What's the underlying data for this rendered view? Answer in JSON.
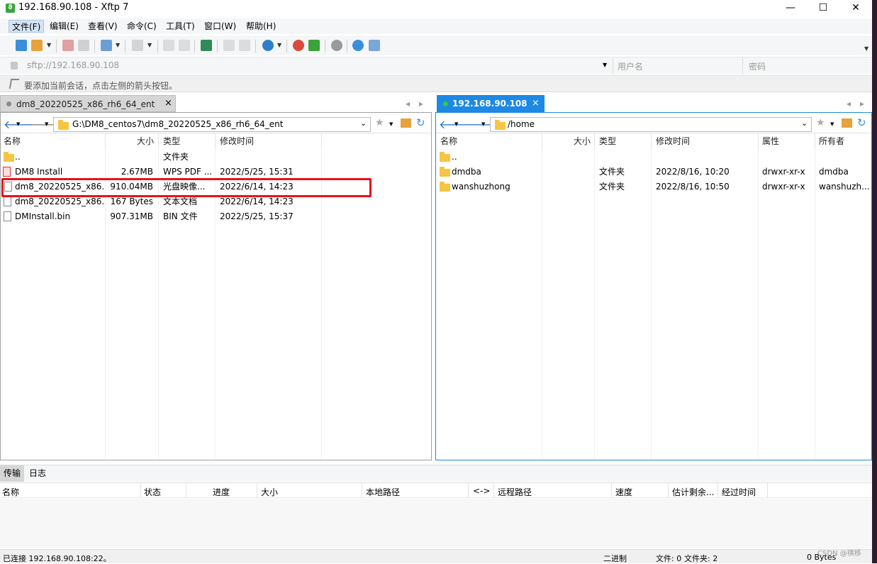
{
  "window": {
    "title": "192.168.90.108 - Xftp 7",
    "minimize": "—",
    "maximize": "☐",
    "close": "✕"
  },
  "menu": [
    {
      "label": "文件(F)"
    },
    {
      "label": "编辑(E)"
    },
    {
      "label": "查看(V)"
    },
    {
      "label": "命令(C)"
    },
    {
      "label": "工具(T)"
    },
    {
      "label": "窗口(W)"
    },
    {
      "label": "帮助(H)"
    }
  ],
  "address": {
    "url": "sftp://192.168.90.108",
    "username_placeholder": "用户名",
    "password_placeholder": "密码"
  },
  "hint": "要添加当前会话，点击左侧的箭头按钮。",
  "left_tab": {
    "label": "dm8_20220525_x86_rh6_64_ent",
    "close": "×"
  },
  "right_tab": {
    "label": "192.168.90.108",
    "close": "×"
  },
  "tab_nav": {
    "prev": "◂",
    "next": "▸"
  },
  "left_pane": {
    "path": "G:\\DM8_centos7\\dm8_20220525_x86_rh6_64_ent",
    "headers": {
      "name": "名称",
      "size": "大小",
      "type": "类型",
      "modified": "修改时间"
    },
    "rows": [
      {
        "name": "..",
        "size": "",
        "type": "文件夹",
        "modified": ""
      },
      {
        "name": "DM8 Install",
        "size": "2.67MB",
        "type": "WPS PDF ...",
        "modified": "2022/5/25, 15:31"
      },
      {
        "name": "dm8_20220525_x86...",
        "size": "910.04MB",
        "type": "光盘映像...",
        "modified": "2022/6/14, 14:23"
      },
      {
        "name": "dm8_20220525_x86...",
        "size": "167 Bytes",
        "type": "文本文档",
        "modified": "2022/6/14, 14:23"
      },
      {
        "name": "DMInstall.bin",
        "size": "907.31MB",
        "type": "BIN 文件",
        "modified": "2022/5/25, 15:37"
      }
    ]
  },
  "right_pane": {
    "path": "/home",
    "headers": {
      "name": "名称",
      "size": "大小",
      "type": "类型",
      "modified": "修改时间",
      "attrs": "属性",
      "owner": "所有者"
    },
    "rows": [
      {
        "name": "..",
        "size": "",
        "type": "",
        "modified": "",
        "attrs": "",
        "owner": ""
      },
      {
        "name": "dmdba",
        "size": "",
        "type": "文件夹",
        "modified": "2022/8/16, 10:20",
        "attrs": "drwxr-xr-x",
        "owner": "dmdba"
      },
      {
        "name": "wanshuzhong",
        "size": "",
        "type": "文件夹",
        "modified": "2022/8/16, 10:50",
        "attrs": "drwxr-xr-x",
        "owner": "wanshuzh..."
      }
    ]
  },
  "bottom": {
    "tabs": [
      {
        "label": "传输"
      },
      {
        "label": "日志"
      }
    ],
    "headers": [
      "名称",
      "状态",
      "进度",
      "大小",
      "本地路径",
      "<->",
      "远程路径",
      "速度",
      "估计剩余...",
      "经过时间"
    ]
  },
  "status": {
    "connection": "已连接 192.168.90.108:22。",
    "mode": "二进制",
    "files": "文件: 0",
    "folders": "文件夹: 2",
    "bytes": "0 Bytes",
    "watermark": "CSDN @祺移"
  },
  "colors": {
    "accent": "#1e88e5",
    "highlight": "#e8121b",
    "folder": "#f6c543"
  }
}
